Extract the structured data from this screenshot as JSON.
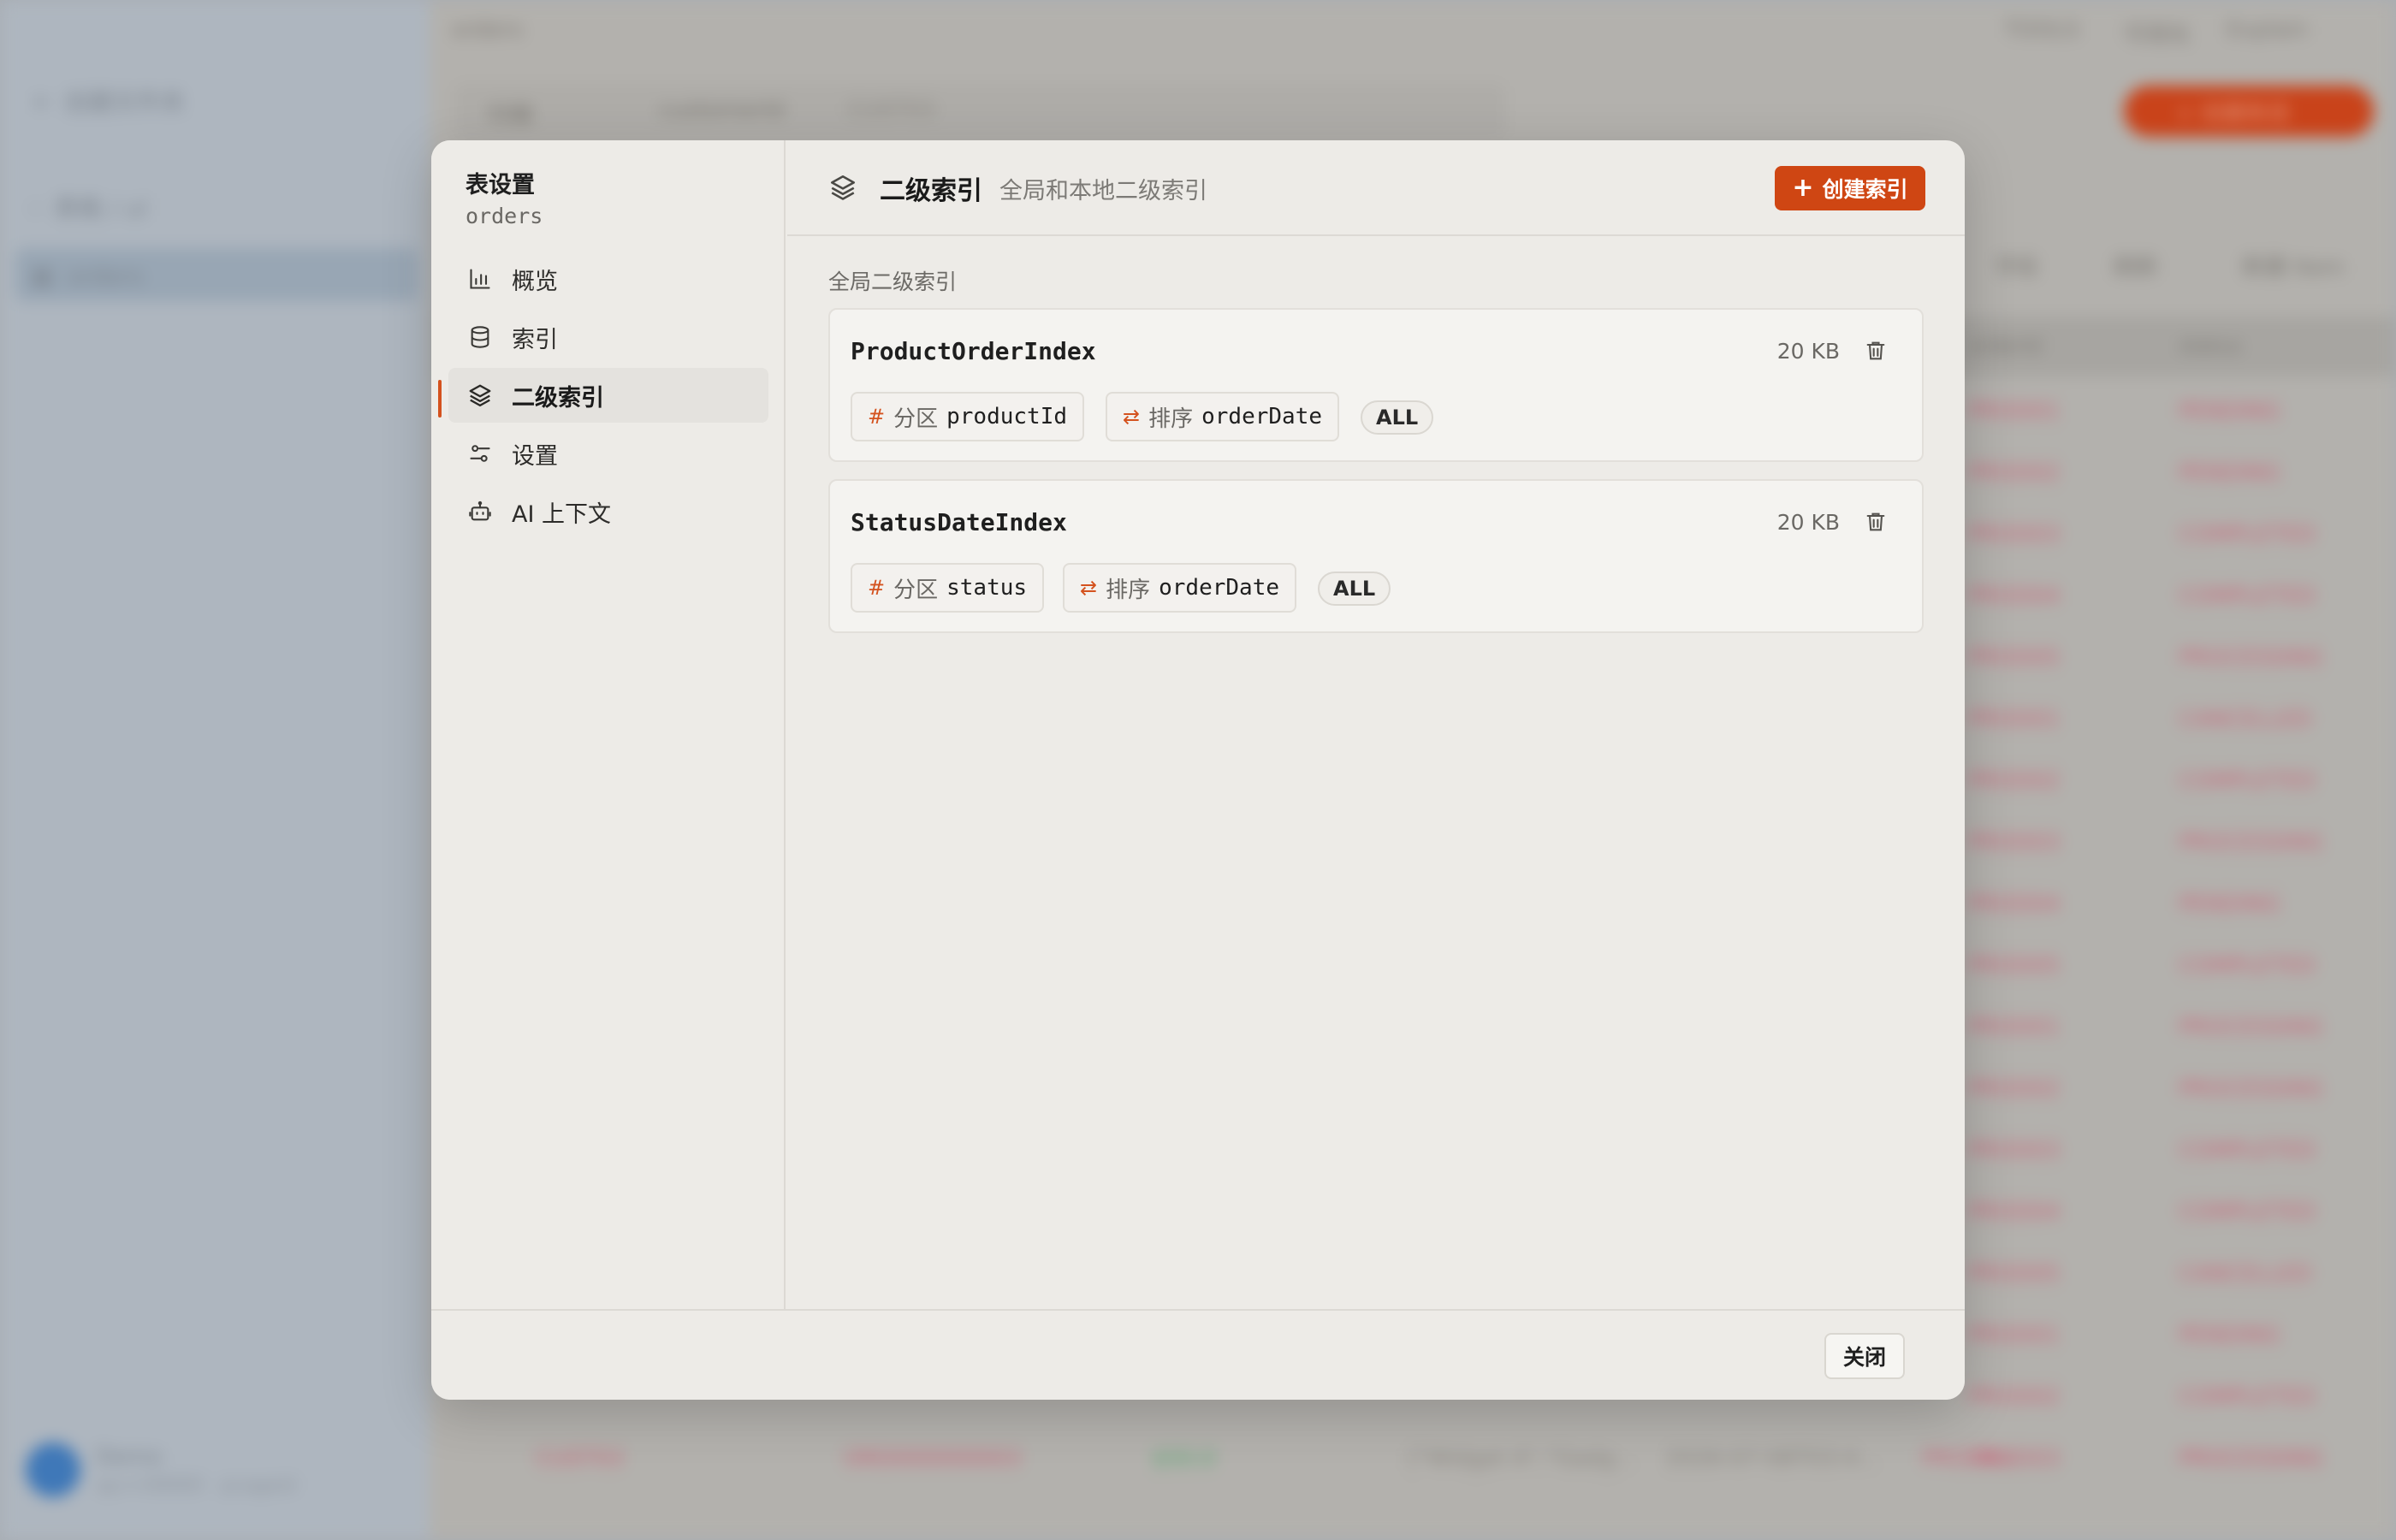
{
  "background": {
    "sidebar": {
      "items": [
        {
          "label": "创建文件夹"
        },
        {
          "label": "表格 / ul"
        },
        {
          "label": "orders"
        }
      ],
      "user": {
        "name": "Demo",
        "meta": "ap-ii-00000 · pcageid"
      }
    },
    "header": {
      "title": "orders",
      "right_items": [
        "TOOLS",
        "可视化",
        "Explain"
      ],
      "primary_label": "+ 创建条目"
    },
    "filter": {
      "scope": "扫描",
      "field": "customerId",
      "value": "CUST03"
    },
    "toolbar": [
      "字段",
      "刷新",
      "新建 Item"
    ],
    "table": {
      "columns": [
        "orderId",
        "status"
      ],
      "status_values": [
        "PENDING",
        "PENDING",
        "COMPLETED",
        "COMPLETED",
        "PROCESSING",
        "CANCELLED",
        "COMPLETED",
        "PROCESSING",
        "PENDING",
        "COMPLETED",
        "PROCESSING",
        "PROCESSING",
        "COMPLETED",
        "COMPLETED",
        "CANCELLED",
        "PENDING",
        "COMPLETED",
        "PROCESSING"
      ],
      "bottom_row": [
        "CUST03",
        "ORD000000003",
        "$50.0",
        "[\"Widget A\",\"Gadg...",
        "2026-07-08T03:4...",
        "PROD02",
        "PROCESSING"
      ]
    }
  },
  "modal": {
    "title": "表设置",
    "table_name": "orders",
    "nav": [
      {
        "label": "概览",
        "icon": "bar-chart-icon"
      },
      {
        "label": "索引",
        "icon": "database-icon"
      },
      {
        "label": "二级索引",
        "icon": "layers-icon",
        "active": true
      },
      {
        "label": "设置",
        "icon": "sliders-icon"
      },
      {
        "label": "AI 上下文",
        "icon": "robot-icon"
      }
    ],
    "section": {
      "title": "二级索引",
      "description": "全局和本地二级索引",
      "create_label": "创建索引",
      "group_label": "全局二级索引"
    },
    "indexes": [
      {
        "name": "ProductOrderIndex",
        "size": "20 KB",
        "partition": {
          "kind": "分区",
          "field": "productId"
        },
        "sort": {
          "kind": "排序",
          "field": "orderDate"
        },
        "projection": "ALL"
      },
      {
        "name": "StatusDateIndex",
        "size": "20 KB",
        "partition": {
          "kind": "分区",
          "field": "status"
        },
        "sort": {
          "kind": "排序",
          "field": "orderDate"
        },
        "projection": "ALL"
      }
    ],
    "footer": {
      "close_label": "关闭"
    },
    "colors": {
      "accent": "#cf4613",
      "indicator": "#d4521e"
    }
  }
}
